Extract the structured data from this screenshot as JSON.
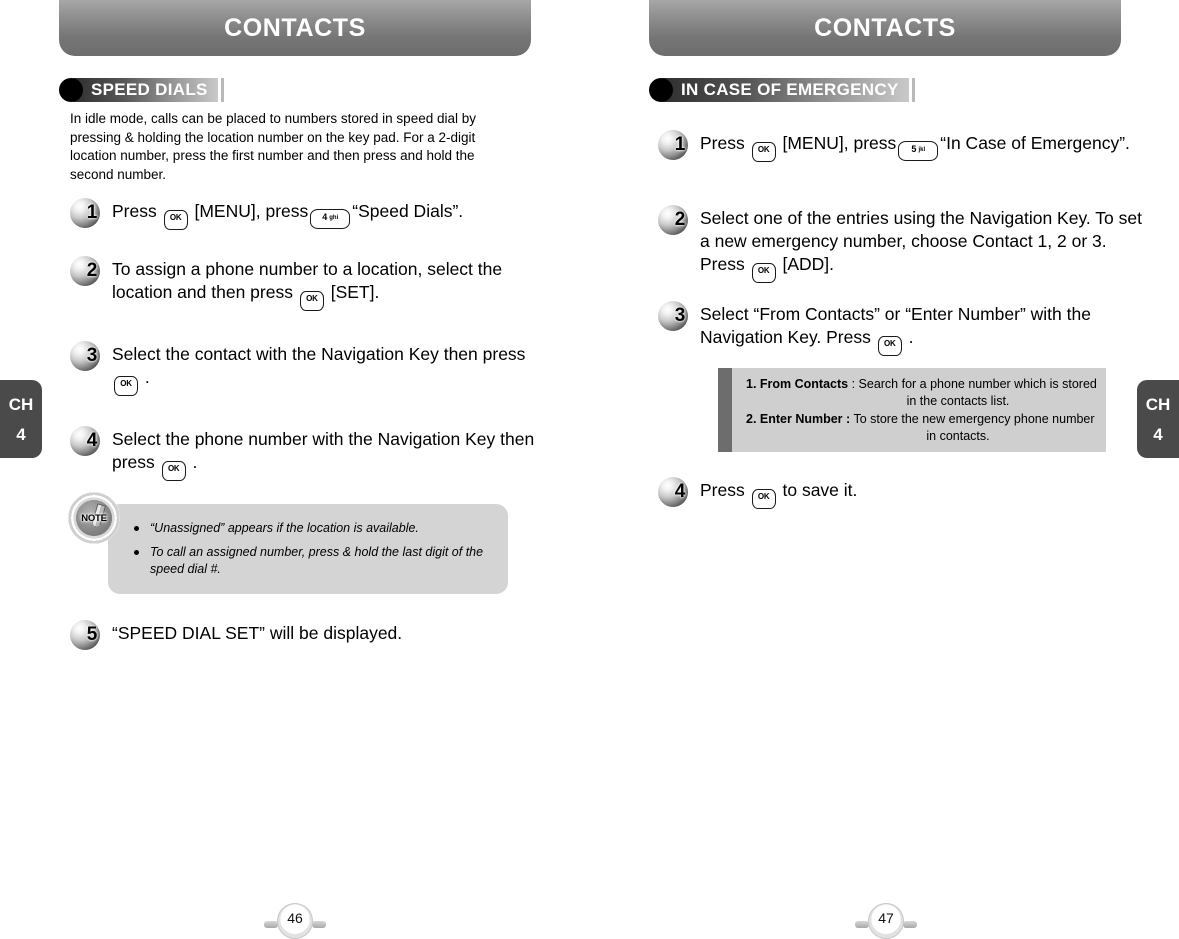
{
  "chapter_tabs": {
    "left": {
      "letters": "CH",
      "number": "4"
    },
    "right": {
      "letters": "CH",
      "number": "4"
    }
  },
  "left_page": {
    "header_title": "CONTACTS",
    "section_title": "SPEED DIALS",
    "intro": "In idle mode, calls can be placed to numbers stored in speed dial by pressing & holding the location number on the key pad. For a 2-digit location number, press the first number and then press and hold the second number.",
    "steps": [
      {
        "number": "1",
        "text_a": "Press",
        "key1": "OK",
        "text_b": "[MENU], press",
        "key2_digit": "4",
        "key2_letters": "ghi",
        "text_c": "“Speed Dials”."
      },
      {
        "number": "2",
        "text_a": "To assign a phone number to a location, select the location and then press",
        "key1": "OK",
        "text_b": "[SET]."
      },
      {
        "number": "3",
        "text_a": "Select the contact with the Navigation Key then press",
        "key1": "OK",
        "text_b": "."
      },
      {
        "number": "4",
        "text_a": "Select the phone number with the Navigation Key then press",
        "key1": "OK",
        "text_b": "."
      },
      {
        "number": "5",
        "text_a": "“SPEED DIAL SET” will be displayed."
      }
    ],
    "note": {
      "badge_label": "NOTE",
      "items": [
        "“Unassigned” appears if the location is available.",
        "To call an assigned number, press & hold the last digit of the speed dial #."
      ]
    },
    "page_number": "46"
  },
  "right_page": {
    "header_title": "CONTACTS",
    "section_title": "IN CASE OF EMERGENCY",
    "steps": [
      {
        "number": "1",
        "text_a": "Press",
        "key1": "OK",
        "text_b": "[MENU], press",
        "key2_digit": "5",
        "key2_letters": "jkl",
        "text_c": "“In Case of Emergency”."
      },
      {
        "number": "2",
        "text_a": "Select one of the entries using the Navigation Key. To set a new emergency number, choose Contact 1, 2 or 3. Press",
        "key1": "OK",
        "text_b": "[ADD]."
      },
      {
        "number": "3",
        "text_a": "Select “From Contacts” or “Enter Number” with the Navigation Key. Press",
        "key1": "OK",
        "text_b": "."
      },
      {
        "number": "4",
        "text_a": "Press",
        "key1": "OK",
        "text_b": "to save it."
      }
    ],
    "info_box": [
      {
        "label": "1. From Contacts",
        "separator": " : ",
        "text": "Search for a phone number which is stored",
        "cont": "in the contacts list."
      },
      {
        "label": "2. Enter Number :",
        "separator": " ",
        "text": "To store the new emergency phone number",
        "cont": "in contacts."
      }
    ],
    "page_number": "47"
  }
}
